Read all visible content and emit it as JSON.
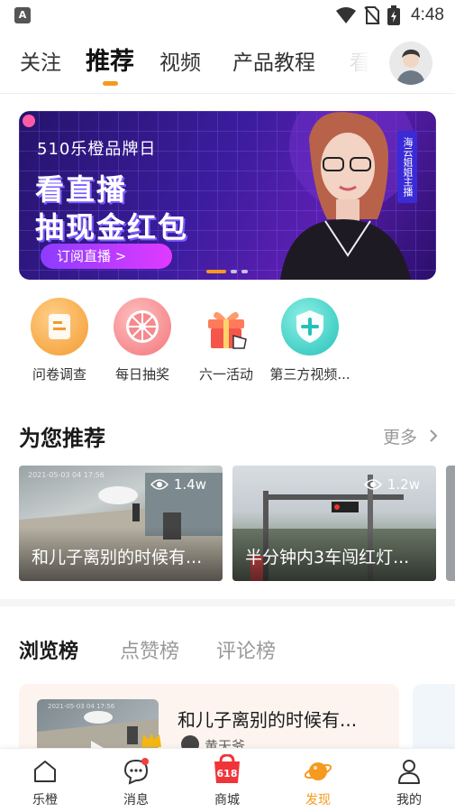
{
  "status_bar": {
    "app_icon": "A",
    "time": "4:48",
    "icons": [
      "wifi-icon",
      "no-sim-icon",
      "battery-charging-icon"
    ]
  },
  "top_nav": {
    "tabs": [
      {
        "label": "关注"
      },
      {
        "label": "推荐",
        "active": true
      },
      {
        "label": "视频"
      },
      {
        "label": "产品教程"
      },
      {
        "label": "看"
      }
    ],
    "accent_color": "#f59a1e"
  },
  "banner": {
    "brand": "510乐橙品牌日",
    "headline_1": "看直播",
    "headline_2": "抽现金红包",
    "cta": "订阅直播 >",
    "host_tag": "海云姐姐主播",
    "slide_count": 3,
    "active_slide": 1
  },
  "quick_actions": [
    {
      "label": "问卷调查",
      "icon": "survey-icon",
      "color": "#f8a645"
    },
    {
      "label": "每日抽奖",
      "icon": "lottery-wheel-icon",
      "color": "#f2757a"
    },
    {
      "label": "六一活动",
      "icon": "gift-icon",
      "color": "#f56a4c"
    },
    {
      "label": "第三方视频...",
      "icon": "shield-plus-icon",
      "color": "#2fc8c0"
    }
  ],
  "recommend": {
    "title": "为您推荐",
    "more": "更多",
    "videos": [
      {
        "title": "和儿子离别的时候有...",
        "views": "1.4w",
        "stamp": "2021-05-03 04 17:56"
      },
      {
        "title": "半分钟内3车闯红灯...",
        "views": "1.2w"
      }
    ]
  },
  "rankings": {
    "tabs": [
      {
        "label": "浏览榜",
        "active": true
      },
      {
        "label": "点赞榜"
      },
      {
        "label": "评论榜"
      }
    ],
    "items": [
      {
        "title": "和儿子离别的时候有...",
        "user": "黄天爷",
        "stamp": "2021-05-03 04 17:56"
      }
    ]
  },
  "bottom_nav": [
    {
      "label": "乐橙",
      "icon": "home-icon"
    },
    {
      "label": "消息",
      "icon": "message-icon",
      "badge": true
    },
    {
      "label": "商城",
      "icon": "shop-618-icon",
      "badge_text": "618"
    },
    {
      "label": "发现",
      "icon": "planet-icon",
      "active": true
    },
    {
      "label": "我的",
      "icon": "profile-icon"
    }
  ]
}
